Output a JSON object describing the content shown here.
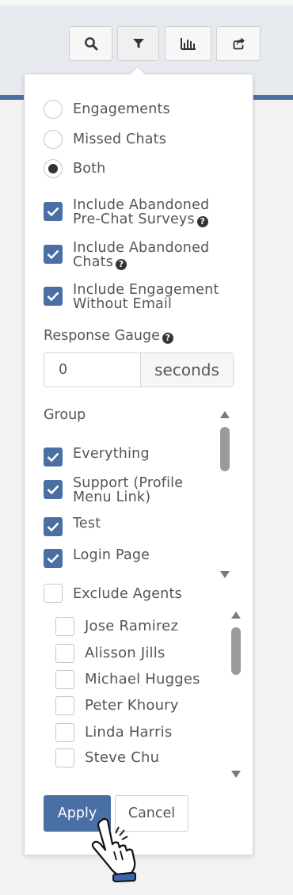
{
  "toolbar": {
    "buttons": [
      {
        "name": "search",
        "icon": "search-icon"
      },
      {
        "name": "filter",
        "icon": "filter-icon"
      },
      {
        "name": "chart",
        "icon": "bar-chart-icon"
      },
      {
        "name": "share",
        "icon": "share-icon"
      }
    ]
  },
  "view_options": {
    "engagements": "Engagements",
    "missed_chats": "Missed Chats",
    "both": "Both",
    "selected": "Both"
  },
  "include": {
    "abandoned_prechat_line1": "Include Abandoned",
    "abandoned_prechat_line2": "Pre-Chat Surveys",
    "abandoned_chats_line1": "Include Abandoned",
    "abandoned_chats_line2": "Chats",
    "no_email_line1": "Include Engagement",
    "no_email_line2": "Without Email"
  },
  "response_gauge": {
    "title": "Response Gauge",
    "value": "0",
    "unit": "seconds"
  },
  "group": {
    "title": "Group",
    "items": [
      {
        "line1": "Everything",
        "line2": "",
        "checked": true
      },
      {
        "line1": "Support (Profile",
        "line2": "Menu Link)",
        "checked": true
      },
      {
        "line1": "Test",
        "line2": "",
        "checked": true
      },
      {
        "line1": "Login Page",
        "line2": "",
        "checked": true
      }
    ]
  },
  "exclude_agents": {
    "label": "Exclude Agents",
    "checked": false,
    "agents": [
      "Jose Ramirez",
      "Alisson Jills",
      "Michael Hugges",
      "Peter Khoury",
      "Linda Harris",
      "Steve Chu"
    ]
  },
  "actions": {
    "apply": "Apply",
    "cancel": "Cancel"
  },
  "colors": {
    "accent": "#4a6fa5",
    "text": "#555555"
  }
}
